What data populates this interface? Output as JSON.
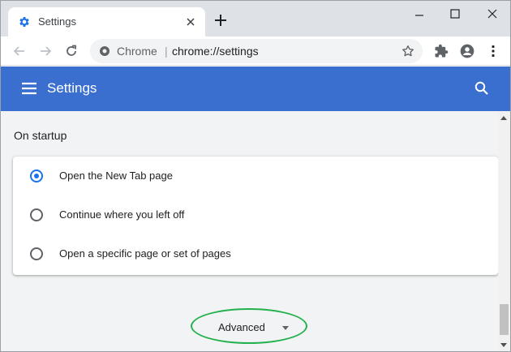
{
  "tab": {
    "title": "Settings",
    "icon": "gear-icon"
  },
  "window_controls": {
    "minimize": "minimize-icon",
    "maximize": "maximize-icon",
    "close": "close-icon"
  },
  "toolbar": {
    "back": "back-arrow-icon",
    "forward": "forward-arrow-icon",
    "reload": "reload-icon",
    "omnibox": {
      "site_label": "Chrome",
      "separator": "|",
      "url": "chrome://settings"
    },
    "bookmark": "star-icon",
    "extensions": "puzzle-icon",
    "profile": "account-icon",
    "menu": "kebab-menu-icon"
  },
  "settings_header": {
    "title": "Settings"
  },
  "startup": {
    "section_title": "On startup",
    "options": [
      {
        "label": "Open the New Tab page",
        "checked": true
      },
      {
        "label": "Continue where you left off",
        "checked": false
      },
      {
        "label": "Open a specific page or set of pages",
        "checked": false
      }
    ]
  },
  "advanced": {
    "label": "Advanced"
  },
  "colors": {
    "header_blue": "#3b6fcf",
    "radio_blue": "#1a73e8",
    "highlight_green": "#22b14c",
    "page_bg": "#f1f3f4"
  }
}
